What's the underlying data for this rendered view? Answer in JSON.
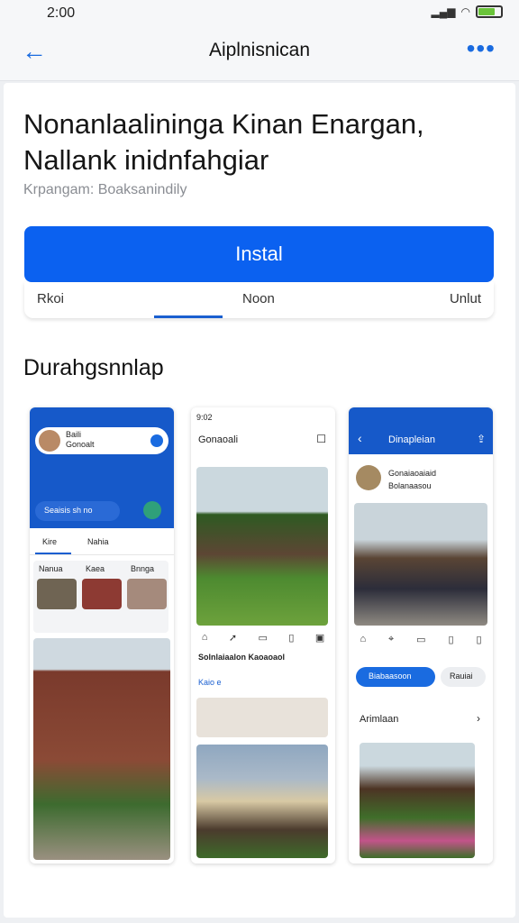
{
  "status": {
    "time": "2:00"
  },
  "appbar": {
    "title": "Aiplnisnican"
  },
  "app": {
    "title": "Nonanlaalininga Kinan Enargan, Nallank inidnfahgiar",
    "subtitle": "Krpangam: Boaksanindily",
    "install_label": "Instal"
  },
  "tabs": [
    "Rkoi",
    "Noon",
    "Unlut"
  ],
  "section_title": "Durahgsnnlap",
  "shots": {
    "one": {
      "head": "Baili",
      "head2": "Gonoalt",
      "search": "Seaisis sh no",
      "tab_a": "Kire",
      "tab_b": "Nahia",
      "cards": [
        "Nanua",
        "Kaea",
        "Bnnga"
      ]
    },
    "two": {
      "time": "9:02",
      "title": "Gonaoali",
      "caption": "Solnlaiaalon Kaoaoaol",
      "sub": "Kaio e"
    },
    "three": {
      "title": "Dinapleian",
      "head": "Gonaiaoaiaid",
      "head2": "Bolanaasou",
      "btn1": "Biabaasoon",
      "btn2": "Rauiai",
      "section": "Arimlaan"
    }
  },
  "colors": {
    "accent": "#0b61f0",
    "app_blue": "#1a5fd0"
  }
}
